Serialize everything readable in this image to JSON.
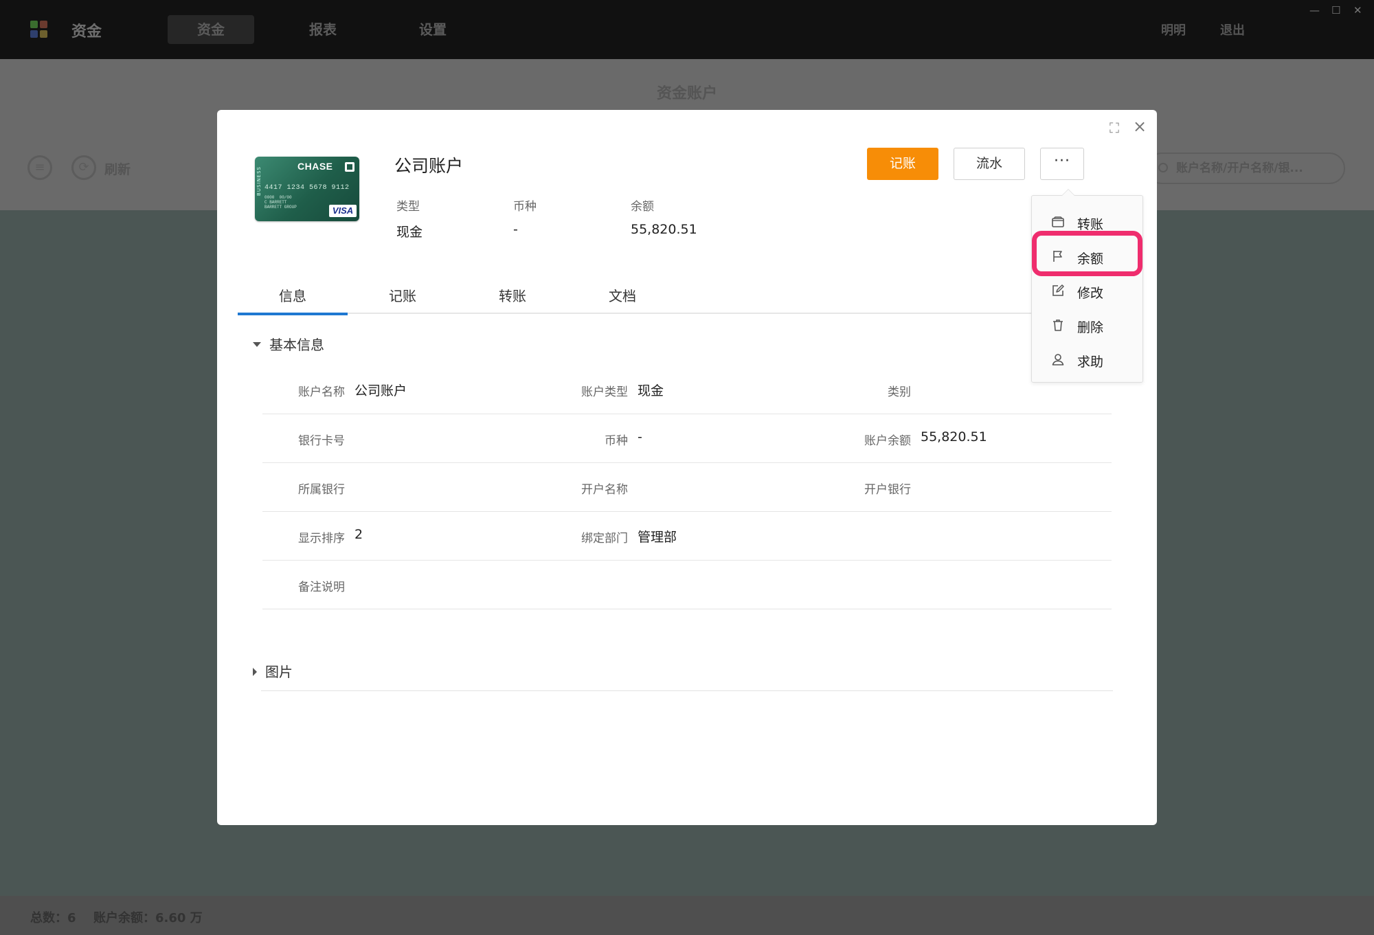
{
  "app": {
    "title": "资金",
    "nav": [
      "资金",
      "报表",
      "设置"
    ],
    "user_links": [
      "明明",
      "退出"
    ],
    "window_controls": [
      "—",
      "☐",
      "✕"
    ]
  },
  "page": {
    "title": "资金账户",
    "toolbar": {
      "refresh_label": "刷新"
    },
    "search_placeholder": "账户名称/开户名称/银..."
  },
  "footer": {
    "total": "总数：6",
    "balance": "账户余额：6.60 万"
  },
  "modal": {
    "account_name": "公司账户",
    "card": {
      "brand": "CHASE",
      "number": "4417 1234 5678 9112",
      "holder_lines": "0000  00/00\nC BARRETT\nBARRETT GROUP",
      "side_text": "BUSINESS",
      "network": "VISA"
    },
    "meta": [
      {
        "label": "类型",
        "value": "现金"
      },
      {
        "label": "币种",
        "value": "-"
      },
      {
        "label": "余额",
        "value": "55,820.51"
      }
    ],
    "buttons": {
      "record": "记账",
      "flow": "流水",
      "more": "···"
    },
    "tabs": [
      "信息",
      "记账",
      "转账",
      "文档"
    ],
    "basic_info": {
      "title": "基本信息",
      "rows": [
        [
          {
            "label": "账户名称",
            "value": "公司账户"
          },
          {
            "label": "账户类型",
            "value": "现金"
          },
          {
            "label": "类别",
            "value": ""
          }
        ],
        [
          {
            "label": "银行卡号",
            "value": ""
          },
          {
            "label": "币种",
            "value": "-"
          },
          {
            "label": "账户余额",
            "value": "55,820.51"
          }
        ],
        [
          {
            "label": "所属银行",
            "value": ""
          },
          {
            "label": "开户名称",
            "value": ""
          },
          {
            "label": "开户银行",
            "value": ""
          }
        ],
        [
          {
            "label": "显示排序",
            "value": "2"
          },
          {
            "label": "绑定部门",
            "value": "管理部"
          }
        ],
        [
          {
            "label": "备注说明",
            "value": ""
          }
        ]
      ]
    },
    "images_section": {
      "title": "图片"
    },
    "more_menu": [
      {
        "label": "转账",
        "icon": "wallet-icon"
      },
      {
        "label": "余额",
        "icon": "flag-icon"
      },
      {
        "label": "修改",
        "icon": "edit-icon"
      },
      {
        "label": "删除",
        "icon": "trash-icon"
      },
      {
        "label": "求助",
        "icon": "user-icon"
      }
    ],
    "highlighted_menu_item": "余额",
    "colors": {
      "primary_button": "#f78d07",
      "active_tab": "#1f78d1",
      "highlight": "#ef2d6e"
    }
  }
}
